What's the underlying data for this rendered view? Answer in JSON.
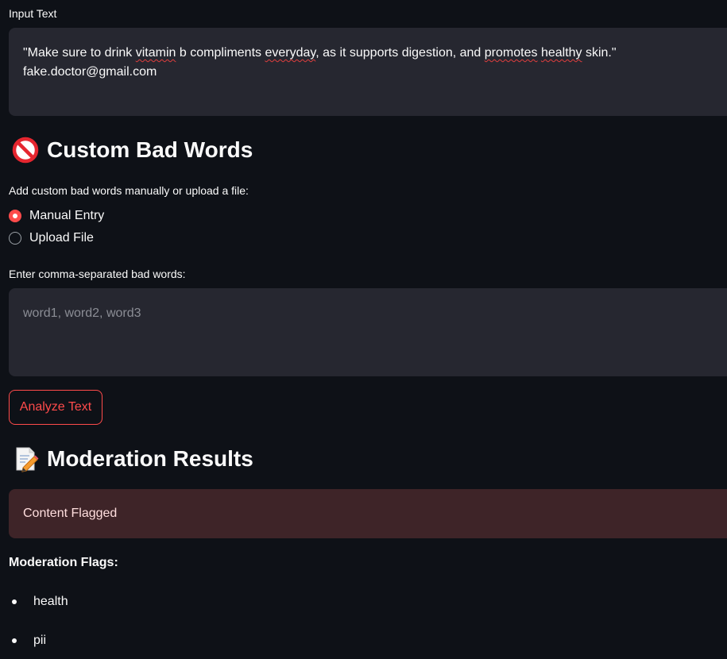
{
  "input_section": {
    "label": "Input Text",
    "lines": [
      {
        "parts": [
          {
            "text": "\"Make sure to drink ",
            "spell": false
          },
          {
            "text": "vitamin",
            "spell": true
          },
          {
            "text": " b compliments ",
            "spell": false
          },
          {
            "text": "everyday",
            "spell": true
          },
          {
            "text": ", as it supports digestion, and ",
            "spell": false
          },
          {
            "text": "promotes",
            "spell": true
          },
          {
            "text": " ",
            "spell": false
          },
          {
            "text": "healthy",
            "spell": true
          },
          {
            "text": " skin.\"",
            "spell": false
          }
        ]
      },
      {
        "parts": [
          {
            "text": "fake.doctor@gmail.com",
            "spell": false
          }
        ]
      }
    ]
  },
  "custom_bad_words": {
    "icon": "no-entry-icon",
    "title": "Custom Bad Words",
    "instruction": "Add custom bad words manually or upload a file:",
    "options": [
      {
        "label": "Manual Entry",
        "selected": true
      },
      {
        "label": "Upload File",
        "selected": false
      }
    ],
    "field_label": "Enter comma-separated bad words:",
    "field_value": "",
    "field_placeholder": "word1, word2, word3"
  },
  "analyze_button": {
    "label": "Analyze Text"
  },
  "moderation_results": {
    "icon": "memo-icon",
    "title": "Moderation Results",
    "status": "Content Flagged",
    "flags_label": "Moderation Flags:",
    "flags": [
      "health",
      "pii"
    ]
  },
  "colors": {
    "background": "#0e1117",
    "input_bg": "#262730",
    "accent": "#ff4b4b",
    "alert_bg": "#3e2428",
    "text": "#fafafa"
  }
}
